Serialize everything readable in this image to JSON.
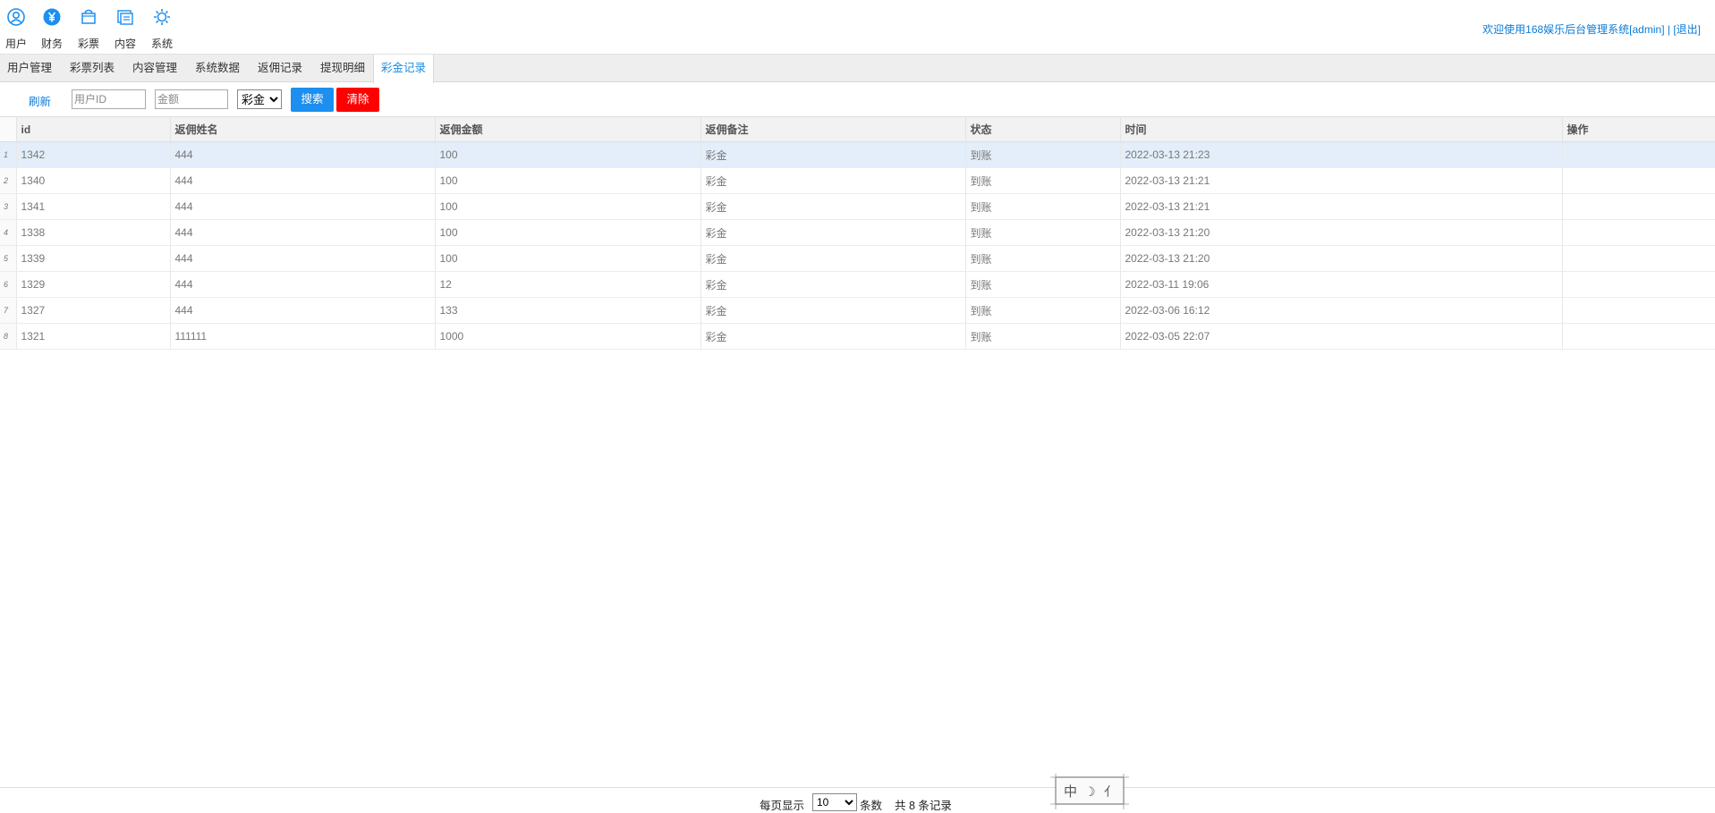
{
  "topnav": {
    "items": [
      {
        "label": "用户",
        "icon": "user-icon"
      },
      {
        "label": "财务",
        "icon": "yen-icon"
      },
      {
        "label": "彩票",
        "icon": "bag-icon"
      },
      {
        "label": "内容",
        "icon": "content-icon"
      },
      {
        "label": "系统",
        "icon": "gear-icon"
      }
    ],
    "welcome_prefix": "欢迎使用168娱乐后台管理系统[admin]",
    "separator": " | ",
    "logout": "[退出]",
    "accent_color": "#0a7bd6"
  },
  "tabs": [
    "用户管理",
    "彩票列表",
    "内容管理",
    "系统数据",
    "返佣记录",
    "提现明细",
    "彩金记录"
  ],
  "active_tab": "彩金记录",
  "toolbar": {
    "refresh": "刷新",
    "user_id_placeholder": "用户ID",
    "amount_placeholder": "金额",
    "type_selected": "彩金",
    "search": "搜索",
    "clear": "清除",
    "search_color": "#1c8ff0",
    "clear_color": "#ff0000"
  },
  "table": {
    "headers": [
      "id",
      "返佣姓名",
      "返佣金额",
      "返佣备注",
      "状态",
      "时间",
      "操作"
    ],
    "rows": [
      {
        "n": "1",
        "id": "1342",
        "name": "444",
        "amount": "100",
        "note": "彩金",
        "status": "到账",
        "time": "2022-03-13 21:23",
        "op": ""
      },
      {
        "n": "2",
        "id": "1340",
        "name": "444",
        "amount": "100",
        "note": "彩金",
        "status": "到账",
        "time": "2022-03-13 21:21",
        "op": ""
      },
      {
        "n": "3",
        "id": "1341",
        "name": "444",
        "amount": "100",
        "note": "彩金",
        "status": "到账",
        "time": "2022-03-13 21:21",
        "op": ""
      },
      {
        "n": "4",
        "id": "1338",
        "name": "444",
        "amount": "100",
        "note": "彩金",
        "status": "到账",
        "time": "2022-03-13 21:20",
        "op": ""
      },
      {
        "n": "5",
        "id": "1339",
        "name": "444",
        "amount": "100",
        "note": "彩金",
        "status": "到账",
        "time": "2022-03-13 21:20",
        "op": ""
      },
      {
        "n": "6",
        "id": "1329",
        "name": "444",
        "amount": "12",
        "note": "彩金",
        "status": "到账",
        "time": "2022-03-11 19:06",
        "op": ""
      },
      {
        "n": "7",
        "id": "1327",
        "name": "444",
        "amount": "133",
        "note": "彩金",
        "status": "到账",
        "time": "2022-03-06 16:12",
        "op": ""
      },
      {
        "n": "8",
        "id": "1321",
        "name": "111111",
        "amount": "1000",
        "note": "彩金",
        "status": "到账",
        "time": "2022-03-05 22:07",
        "op": ""
      }
    ],
    "selected_row": 0
  },
  "footer": {
    "per_page_label": "每页显示",
    "per_page_value": "10",
    "per_page_unit": "条数",
    "total": "共 8 条记录"
  },
  "stamp": {
    "chars": [
      "中",
      "☽",
      "⺅"
    ]
  }
}
